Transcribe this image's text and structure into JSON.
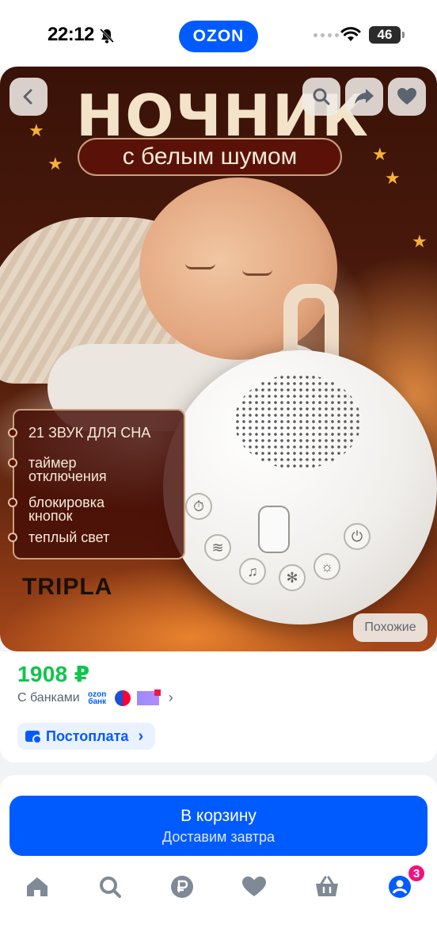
{
  "status_bar": {
    "time": "22:12",
    "app_pill": "OZON",
    "battery": "46"
  },
  "product": {
    "image": {
      "headline": "НОЧНИК",
      "subheadline": "с белым шумом",
      "features": [
        "21 ЗВУК ДЛЯ СНА",
        "таймер отключения",
        "блокировка кнопок",
        "теплый свет"
      ],
      "brand": "TRIPLA"
    },
    "similar_label": "Похожие",
    "price": "1908 ₽",
    "banks_label": "С банками",
    "ozon_bank_logo": "ozon банк",
    "postpay_label": "Постоплата"
  },
  "cart": {
    "title": "В корзину",
    "subtitle": "Доставим завтра"
  },
  "tabbar": {
    "items": [
      {
        "icon": "home-icon"
      },
      {
        "icon": "search-icon"
      },
      {
        "icon": "ruble-icon"
      },
      {
        "icon": "heart-icon"
      },
      {
        "icon": "basket-icon"
      },
      {
        "icon": "profile-icon",
        "badge": "3"
      }
    ]
  },
  "colors": {
    "brand": "#005bff",
    "price": "#10c44c",
    "badge": "#f1117e"
  }
}
